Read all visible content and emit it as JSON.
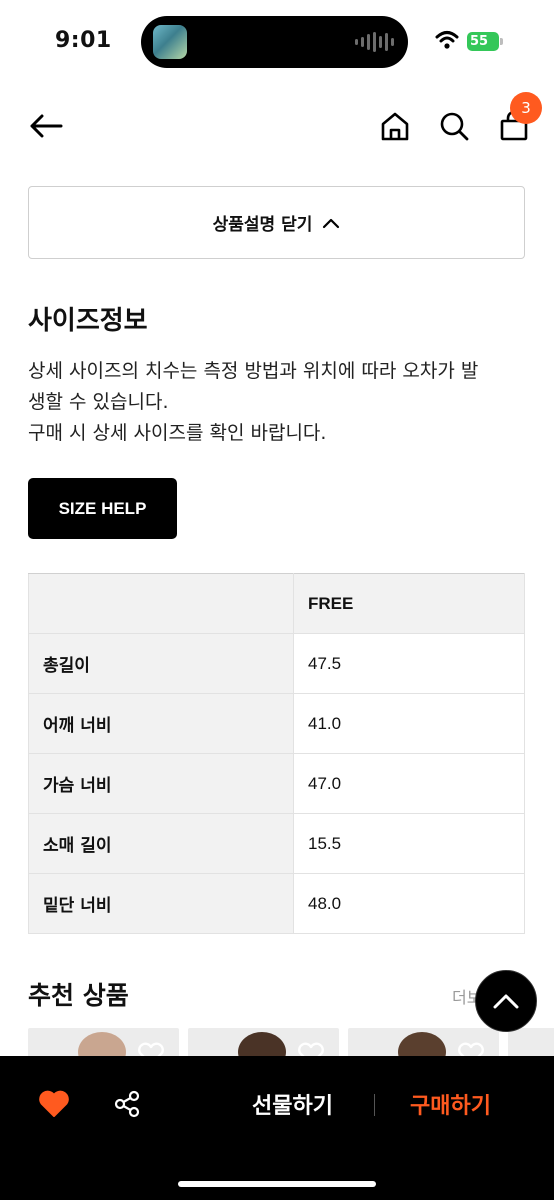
{
  "status_bar": {
    "time": "9:01",
    "battery": "55",
    "icons": [
      "now-playing-thumbnail",
      "audio-waveform-icon",
      "wifi-icon",
      "battery-icon"
    ]
  },
  "header": {
    "icons": [
      "back-arrow-icon",
      "home-icon",
      "search-icon",
      "shopping-bag-icon"
    ],
    "cart_count": "3"
  },
  "collapse": {
    "label": "상품설명 닫기"
  },
  "size_info": {
    "title": "사이즈정보",
    "description_line1": "상세 사이즈의 치수는 측정 방법과 위치에 따라 오차가 발",
    "description_line2": "생할 수 있습니다.",
    "description_line3": "구매 시 상세 사이즈를 확인 바랍니다.",
    "help_button": "SIZE HELP"
  },
  "size_table": {
    "column_header": "FREE",
    "rows": [
      {
        "label": "총길이",
        "value": "47.5"
      },
      {
        "label": "어깨 너비",
        "value": "41.0"
      },
      {
        "label": "가슴 너비",
        "value": "47.0"
      },
      {
        "label": "소매 길이",
        "value": "15.5"
      },
      {
        "label": "밑단 너비",
        "value": "48.0"
      }
    ]
  },
  "recommended": {
    "title": "추천 상품",
    "more_label": "더보"
  },
  "bottom_bar": {
    "gift_label": "선물하기",
    "buy_label": "구매하기"
  },
  "colors": {
    "accent": "#ff5a1f",
    "bar_background": "#000000",
    "table_header": "#f2f2f2"
  }
}
